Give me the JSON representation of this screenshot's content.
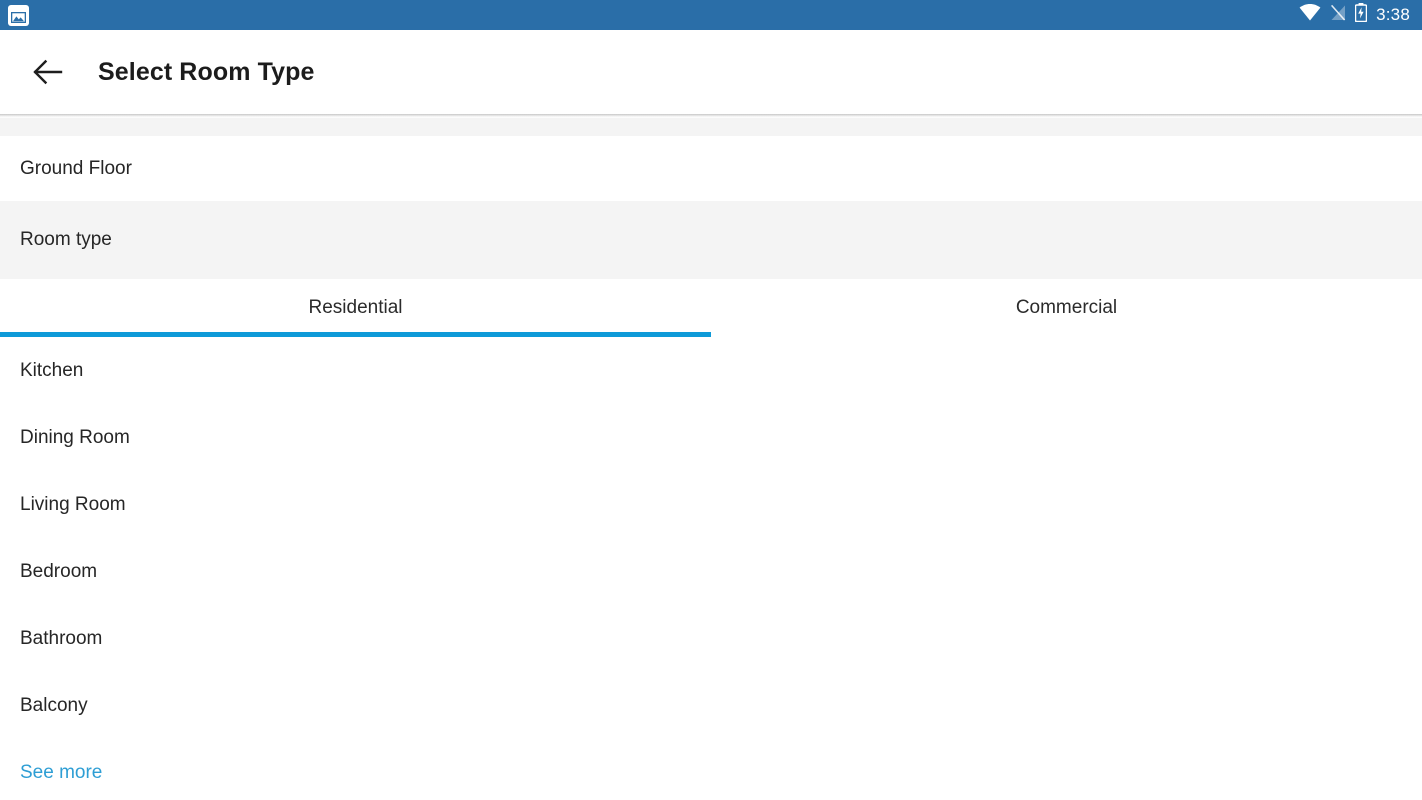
{
  "status_bar": {
    "background_color": "#2a6ea8",
    "notification_icon": "image-notification-icon",
    "wifi_icon": "wifi-icon",
    "signal_off_icon": "signal-no-sim-icon",
    "battery_icon": "battery-charging-icon",
    "time": "3:38"
  },
  "app_bar": {
    "back_icon": "back-arrow-icon",
    "title": "Select Room Type"
  },
  "sections": {
    "floor_label": "Ground Floor",
    "room_type_label": "Room type"
  },
  "tabs": {
    "active_index": 0,
    "indicator_color": "#0e9ad8",
    "items": [
      {
        "label": "Residential"
      },
      {
        "label": "Commercial"
      }
    ]
  },
  "room_list": {
    "items": [
      {
        "label": "Kitchen"
      },
      {
        "label": "Dining Room"
      },
      {
        "label": "Living Room"
      },
      {
        "label": "Bedroom"
      },
      {
        "label": "Bathroom"
      },
      {
        "label": "Balcony"
      }
    ],
    "see_more_label": "See more",
    "link_color": "#2e9ed4"
  }
}
